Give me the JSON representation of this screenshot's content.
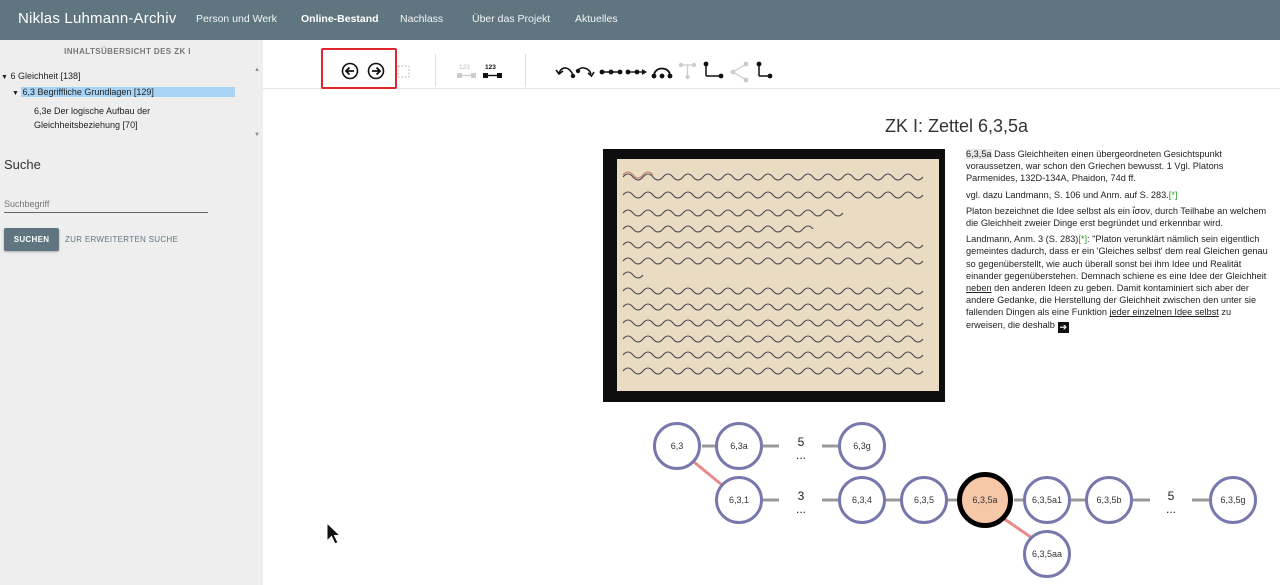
{
  "header": {
    "brand": "Niklas Luhmann-Archiv",
    "nav": [
      {
        "label": "Person und Werk"
      },
      {
        "label": "Online-Bestand"
      },
      {
        "label": "Nachlass"
      },
      {
        "label": "Über das Projekt"
      },
      {
        "label": "Aktuelles"
      }
    ],
    "active": "Online-Bestand",
    "color": "#5f7680"
  },
  "sidebar": {
    "toc_title": "INHALTSÜBERSICHT DES ZK I",
    "items": [
      {
        "label": "6 Gleichheit [138]",
        "expanded": true
      },
      {
        "label": "6,3 Begriffliche Grundlagen [129]",
        "expanded": true,
        "selected": true
      },
      {
        "label_line1": "6,3e Der logische Aufbau der",
        "label_line2": "Gleichheitsbeziehung [70]"
      }
    ],
    "search": {
      "title": "Suche",
      "placeholder": "Suchbegriff",
      "button": "SUCHEN",
      "advanced": "ZUR ERWEITERTEN SUCHE"
    }
  },
  "toolbar": {
    "icons": [
      "arrow-left-circle-icon",
      "arrow-right-circle-icon",
      "select-box-icon",
      "numbering-off-icon",
      "numbering-on-icon",
      "link-back-icon",
      "link-forward-icon",
      "chain-left-icon",
      "chain-right-icon",
      "arc-icon",
      "tree-disabled-icon",
      "branch-icon",
      "share-disabled-icon",
      "sub-branch-icon"
    ],
    "numbers_label": "123",
    "highlight_color": "#e0272e"
  },
  "zettel": {
    "title": "ZK I: Zettel 6,3,5a",
    "transcript": {
      "sig": "6,3,5a",
      "p1": " Dass Gleichheiten einen übergeordneten Gesichtspunkt voraussetzen, war schon den Griechen bewusst. 1 Vgl. Platons Parmenides, 132D-134A, Phaidon, 74d ff.",
      "p2_text": "vgl. dazu Landmann, S. 106 und Anm. auf S. 283.",
      "p2_mark": "[*]",
      "p3": "Platon bezeichnet die Idee selbst als ein ἴσον, durch Teilhabe an welchem die Gleichheit zweier Dinge erst begründet und erkennbar wird.",
      "p4_a": "Landmann, Anm. 3 (S. 283)",
      "p4_mark": "[*]",
      "p4_b": ": \"Platon verunklärt nämlich sein eigentlich gemeintes dadurch, dass er ein 'Gleiches selbst' dem real Gleichen genau so gegenüberstellt, wie auch überall sonst bei ihm Idee und Realität einander gegenüberstehen. Demnach schiene es eine Idee der Gleichheit ",
      "p4_u1": "neben",
      "p4_c": " den anderen Ideen zu geben. Damit kontaminiert sich aber der andere Gedanke, die Herstellung der Gleichheit zwischen den unter sie fallenden Dingen als eine Funktion ",
      "p4_u2": "jeder einzelnen Idee selbst",
      "p4_d": " zu erweisen, die deshalb"
    },
    "green": "#2a9a2a"
  },
  "graph": {
    "nodes": [
      "6,3",
      "6,3a",
      "6,3g",
      "6,3,1",
      "6,3,4",
      "6,3,5",
      "6,3,5a",
      "6,3,5a1",
      "6,3,5b",
      "6,3,5g",
      "6,3,5aa"
    ],
    "current": "6,3,5a",
    "gaps": [
      {
        "count": "5",
        "dots": "..."
      },
      {
        "count": "3",
        "dots": "..."
      },
      {
        "count": "5",
        "dots": "..."
      }
    ],
    "node_border": "#7878ac",
    "current_fill": "#f7c8a8",
    "child_link": "#e88a8a"
  }
}
